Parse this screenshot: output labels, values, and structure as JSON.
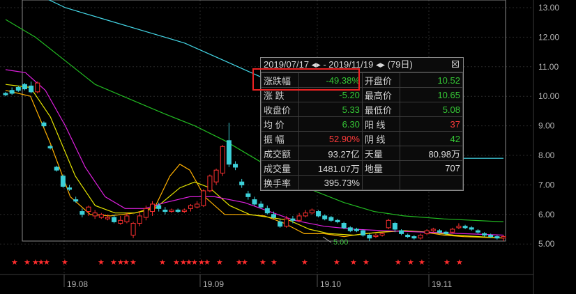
{
  "chart_data": {
    "type": "candlestick",
    "y_ticks": [
      "13.00",
      "12.00",
      "11.00",
      "10.00",
      "9.00",
      "8.00",
      "7.00",
      "6.00",
      "5.00"
    ],
    "x_ticks": [
      "19.08",
      "19.09",
      "19.10",
      "19.11"
    ],
    "low_marker": "5.00",
    "star_marks": "★",
    "ylim": [
      4.75,
      13.25
    ],
    "grid": true,
    "candles": [
      [
        10.1,
        10.05,
        10.15,
        10.0
      ],
      [
        10.2,
        10.1,
        10.3,
        10.05
      ],
      [
        10.3,
        10.2,
        10.35,
        10.15
      ],
      [
        10.4,
        10.25,
        10.45,
        10.2
      ],
      [
        10.35,
        10.15,
        10.5,
        10.1
      ],
      [
        10.15,
        10.45,
        10.5,
        10.1
      ],
      [
        9.1,
        9.0,
        9.15,
        8.95
      ],
      [
        8.3,
        8.25,
        8.35,
        8.2
      ],
      [
        7.6,
        7.5,
        7.65,
        7.45
      ],
      [
        7.3,
        6.95,
        7.35,
        6.9
      ],
      [
        6.9,
        6.85,
        7.0,
        6.8
      ],
      [
        6.5,
        6.45,
        6.6,
        6.4
      ],
      [
        6.1,
        6.0,
        6.2,
        5.9
      ],
      [
        6.1,
        6.25,
        6.3,
        5.95
      ],
      [
        5.95,
        6.05,
        6.15,
        5.85
      ],
      [
        5.9,
        6.0,
        6.05,
        5.85
      ],
      [
        5.85,
        5.9,
        6.0,
        5.8
      ],
      [
        5.9,
        5.75,
        6.0,
        5.7
      ],
      [
        5.7,
        5.8,
        5.95,
        5.65
      ],
      [
        5.75,
        5.95,
        6.05,
        5.7
      ],
      [
        5.3,
        5.7,
        5.75,
        5.2
      ],
      [
        5.7,
        5.95,
        6.1,
        5.6
      ],
      [
        5.9,
        6.2,
        6.3,
        5.8
      ],
      [
        6.1,
        6.35,
        6.45,
        5.95
      ],
      [
        6.3,
        6.2,
        6.4,
        6.1
      ],
      [
        6.15,
        6.1,
        6.25,
        6.0
      ],
      [
        6.1,
        6.15,
        6.2,
        6.05
      ],
      [
        6.15,
        6.1,
        6.2,
        6.05
      ],
      [
        6.1,
        6.15,
        6.2,
        6.05
      ],
      [
        6.2,
        6.3,
        6.35,
        6.1
      ],
      [
        6.25,
        6.35,
        6.45,
        6.2
      ],
      [
        6.3,
        6.8,
        6.85,
        6.25
      ],
      [
        6.8,
        7.3,
        7.35,
        6.75
      ],
      [
        7.1,
        7.5,
        7.55,
        7.0
      ],
      [
        7.4,
        8.3,
        8.35,
        7.3
      ],
      [
        8.5,
        7.7,
        9.1,
        7.6
      ],
      [
        7.7,
        7.6,
        7.8,
        7.5
      ],
      [
        7.1,
        7.0,
        7.2,
        6.9
      ],
      [
        6.7,
        6.6,
        6.8,
        6.5
      ],
      [
        6.5,
        6.35,
        6.6,
        6.3
      ],
      [
        6.35,
        6.25,
        6.45,
        6.2
      ],
      [
        6.2,
        6.05,
        6.3,
        6.0
      ],
      [
        6.0,
        5.9,
        6.1,
        5.85
      ],
      [
        5.75,
        5.6,
        5.85,
        5.55
      ],
      [
        5.6,
        5.85,
        5.95,
        5.55
      ],
      [
        5.85,
        5.8,
        5.95,
        5.7
      ],
      [
        5.8,
        5.95,
        6.05,
        5.75
      ],
      [
        5.95,
        6.05,
        6.15,
        5.9
      ],
      [
        6.05,
        6.15,
        6.2,
        6.0
      ],
      [
        6.1,
        5.95,
        6.15,
        5.9
      ],
      [
        5.95,
        5.85,
        6.0,
        5.8
      ],
      [
        5.9,
        5.8,
        5.95,
        5.75
      ],
      [
        5.8,
        5.75,
        5.85,
        5.7
      ],
      [
        5.7,
        5.55,
        5.75,
        5.5
      ],
      [
        5.55,
        5.45,
        5.6,
        5.4
      ],
      [
        5.5,
        5.45,
        5.55,
        5.4
      ],
      [
        5.45,
        5.3,
        5.5,
        5.25
      ],
      [
        5.3,
        5.2,
        5.35,
        5.1
      ],
      [
        5.25,
        5.3,
        5.35,
        5.2
      ],
      [
        5.3,
        5.35,
        5.4,
        5.25
      ],
      [
        5.55,
        5.8,
        5.85,
        5.5
      ],
      [
        5.7,
        5.5,
        5.75,
        5.4
      ],
      [
        5.45,
        5.35,
        5.5,
        5.3
      ],
      [
        5.3,
        5.25,
        5.35,
        5.2
      ],
      [
        5.25,
        5.2,
        5.3,
        5.15
      ],
      [
        5.2,
        5.3,
        5.35,
        5.15
      ],
      [
        5.35,
        5.45,
        5.5,
        5.3
      ],
      [
        5.45,
        5.5,
        5.55,
        5.4
      ],
      [
        5.45,
        5.4,
        5.5,
        5.35
      ],
      [
        5.4,
        5.35,
        5.45,
        5.3
      ],
      [
        5.4,
        5.5,
        5.55,
        5.35
      ],
      [
        5.55,
        5.6,
        5.7,
        5.5
      ],
      [
        5.6,
        5.55,
        5.65,
        5.5
      ],
      [
        5.55,
        5.5,
        5.6,
        5.45
      ],
      [
        5.45,
        5.4,
        5.5,
        5.35
      ],
      [
        5.35,
        5.3,
        5.4,
        5.25
      ],
      [
        5.3,
        5.25,
        5.35,
        5.2
      ],
      [
        5.25,
        5.2,
        5.3,
        5.15
      ],
      [
        5.2,
        5.25,
        5.3,
        5.1
      ]
    ],
    "ma_lines": [
      {
        "color": "#ffb000",
        "points": [
          [
            0,
            10.2
          ],
          [
            0.05,
            10.0
          ],
          [
            0.09,
            8.4
          ],
          [
            0.13,
            6.6
          ],
          [
            0.17,
            6.0
          ],
          [
            0.21,
            5.95
          ],
          [
            0.26,
            6.05
          ],
          [
            0.3,
            6.25
          ],
          [
            0.33,
            7.3
          ],
          [
            0.35,
            7.7
          ],
          [
            0.37,
            7.5
          ],
          [
            0.4,
            6.6
          ],
          [
            0.44,
            6.0
          ],
          [
            0.48,
            6.0
          ],
          [
            0.52,
            5.95
          ],
          [
            0.56,
            5.7
          ],
          [
            0.6,
            5.35
          ],
          [
            0.64,
            5.35
          ],
          [
            0.68,
            5.25
          ],
          [
            0.72,
            5.35
          ],
          [
            0.76,
            5.4
          ],
          [
            0.8,
            5.45
          ],
          [
            0.84,
            5.4
          ],
          [
            0.88,
            5.3
          ],
          [
            0.92,
            5.25
          ],
          [
            1.0,
            5.2
          ]
        ]
      },
      {
        "color": "#e6e600",
        "points": [
          [
            0,
            10.4
          ],
          [
            0.05,
            10.3
          ],
          [
            0.09,
            9.3
          ],
          [
            0.14,
            7.3
          ],
          [
            0.18,
            6.3
          ],
          [
            0.22,
            6.05
          ],
          [
            0.26,
            6.05
          ],
          [
            0.3,
            6.2
          ],
          [
            0.35,
            6.9
          ],
          [
            0.38,
            7.1
          ],
          [
            0.41,
            6.9
          ],
          [
            0.45,
            6.3
          ],
          [
            0.49,
            6.0
          ],
          [
            0.53,
            5.9
          ],
          [
            0.57,
            5.8
          ],
          [
            0.61,
            5.5
          ],
          [
            0.65,
            5.35
          ],
          [
            0.7,
            5.3
          ],
          [
            0.75,
            5.4
          ],
          [
            0.8,
            5.45
          ],
          [
            0.85,
            5.4
          ],
          [
            0.9,
            5.3
          ],
          [
            0.95,
            5.25
          ],
          [
            1.0,
            5.2
          ]
        ]
      },
      {
        "color": "#e020e0",
        "points": [
          [
            0,
            10.9
          ],
          [
            0.04,
            10.8
          ],
          [
            0.08,
            10.2
          ],
          [
            0.12,
            9.0
          ],
          [
            0.16,
            7.6
          ],
          [
            0.2,
            6.6
          ],
          [
            0.24,
            6.2
          ],
          [
            0.28,
            6.2
          ],
          [
            0.32,
            6.4
          ],
          [
            0.37,
            6.6
          ],
          [
            0.42,
            6.6
          ],
          [
            0.48,
            6.4
          ],
          [
            0.53,
            6.1
          ],
          [
            0.58,
            5.8
          ],
          [
            0.64,
            5.6
          ],
          [
            0.7,
            5.5
          ],
          [
            0.76,
            5.45
          ],
          [
            0.84,
            5.4
          ],
          [
            0.92,
            5.35
          ],
          [
            1.0,
            5.3
          ]
        ]
      },
      {
        "color": "#22bb22",
        "points": [
          [
            0,
            12.6
          ],
          [
            0.06,
            12.0
          ],
          [
            0.12,
            11.2
          ],
          [
            0.18,
            10.4
          ],
          [
            0.25,
            9.9
          ],
          [
            0.32,
            9.4
          ],
          [
            0.38,
            9.0
          ],
          [
            0.44,
            8.5
          ],
          [
            0.5,
            7.9
          ],
          [
            0.56,
            7.3
          ],
          [
            0.62,
            6.8
          ],
          [
            0.68,
            6.4
          ],
          [
            0.74,
            6.1
          ],
          [
            0.8,
            5.95
          ],
          [
            0.88,
            5.85
          ],
          [
            1.0,
            5.75
          ]
        ]
      },
      {
        "color": "#44d8e8",
        "points": [
          [
            0.07,
            13.4
          ],
          [
            0.12,
            13.0
          ],
          [
            0.2,
            12.6
          ],
          [
            0.28,
            12.2
          ],
          [
            0.36,
            11.8
          ],
          [
            0.44,
            11.2
          ],
          [
            0.52,
            10.6
          ],
          [
            0.6,
            10.0
          ],
          [
            0.68,
            9.4
          ],
          [
            0.76,
            8.8
          ],
          [
            0.84,
            8.3
          ],
          [
            0.92,
            7.9
          ],
          [
            1.0,
            7.9
          ]
        ]
      }
    ]
  },
  "stat_popup": {
    "header": "2019/07/17 ◂▸ - 2019/11/19 ◂▸ (79日)",
    "rows": [
      {
        "l1": "涨跌幅",
        "v1": "-49.38%",
        "c1": "green",
        "l2": "开盘价",
        "v2": "10.52",
        "c2": "green"
      },
      {
        "l1": "涨  跌",
        "v1": "-5.20",
        "c1": "green",
        "l2": "最高价",
        "v2": "10.65",
        "c2": "green"
      },
      {
        "l1": "收盘价",
        "v1": "5.33",
        "c1": "green",
        "l2": "最低价",
        "v2": "5.08",
        "c2": "green"
      },
      {
        "l1": "均  价",
        "v1": "6.30",
        "c1": "green",
        "l2": "阳  线",
        "v2": "37",
        "c2": "red"
      },
      {
        "l1": "振  幅",
        "v1": "52.90%",
        "c1": "red",
        "l2": "阴  线",
        "v2": "42",
        "c2": "green"
      },
      {
        "l1": "成交额",
        "v1": "93.27亿",
        "c1": "white",
        "l2": "天量",
        "v2": "80.98万",
        "c2": "white"
      },
      {
        "l1": "成交量",
        "v1": "1481.07万",
        "c1": "white",
        "l2": "地量",
        "v2": "707",
        "c2": "white"
      },
      {
        "l1": "换手率",
        "v1": "395.73%",
        "c1": "white",
        "l2": "",
        "v2": "",
        "c2": "white"
      }
    ]
  }
}
